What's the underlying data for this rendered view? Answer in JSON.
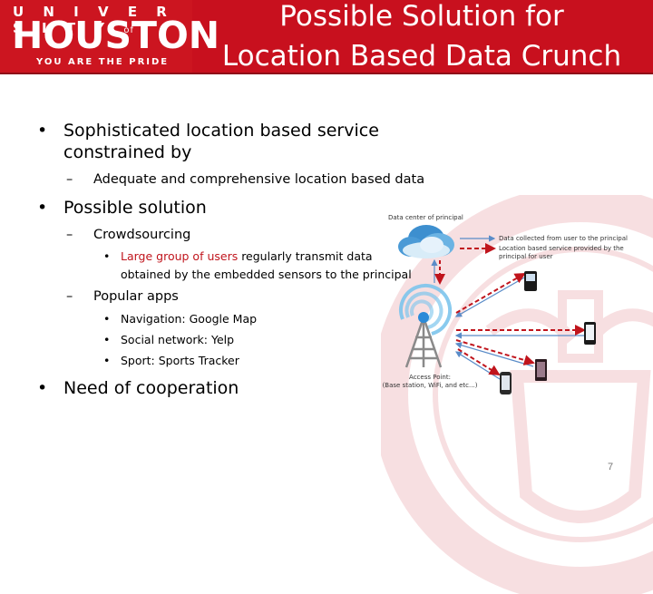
{
  "header": {
    "logo": {
      "university": "U N I V E R S I T Y",
      "of": "of",
      "name": "HOUSTON",
      "tagline": "YOU ARE THE PRIDE"
    },
    "title_line1": "Possible Solution for",
    "title_line2": "Location Based Data Crunch"
  },
  "body": {
    "b1_line1": "Sophisticated location based service",
    "b1_line2": "constrained by",
    "b1_sub1": "Adequate and comprehensive location based data",
    "b2": "Possible solution",
    "b2_sub1": "Crowdsourcing",
    "b2_sub1_item_red": "Large  group of users",
    "b2_sub1_item_rest": " regularly transmit data",
    "b2_sub1_item_line2": "obtained by the embedded sensors to the principal",
    "b2_sub2": "Popular apps",
    "b2_sub2_items": [
      "Navigation: Google Map",
      "Social network: Yelp",
      "Sport: Sports Tracker"
    ],
    "b3": "Need of cooperation",
    "bullet": "•",
    "dash": "–"
  },
  "diagram": {
    "cloud_label": "Data center of principal",
    "legend_solid": "Data collected from user to the principal",
    "legend_dashed_line1": "Location based service provided by the",
    "legend_dashed_line2": "principal for user",
    "ap_label_line1": "Access Point:",
    "ap_label_line2": "(Base station, WiFi, and etc...)",
    "colors": {
      "solid": "#5a8cc8",
      "dashed": "#c0141c"
    }
  },
  "footer": {
    "page_number": "7"
  },
  "colors": {
    "header_red": "#c8101e",
    "accent_red": "#c0141c"
  }
}
